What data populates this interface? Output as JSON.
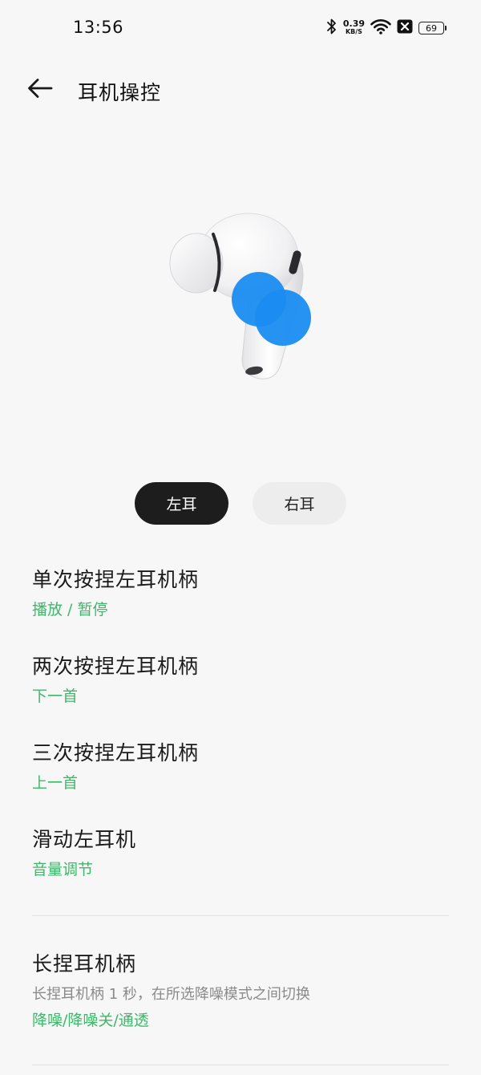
{
  "status_bar": {
    "time": "13:56",
    "net_speed_value": "0.39",
    "net_speed_unit": "KB/S",
    "battery": "69",
    "icons": [
      "bluetooth-icon",
      "wifi-icon",
      "notification-icon",
      "battery-icon"
    ]
  },
  "header": {
    "title": "耳机操控",
    "back_icon": "arrow-left-icon"
  },
  "ear_toggle": {
    "left_label": "左耳",
    "right_label": "右耳",
    "selected": "left"
  },
  "controls": [
    {
      "title": "单次按捏左耳机柄",
      "value": "播放 / 暂停"
    },
    {
      "title": "两次按捏左耳机柄",
      "value": "下一首"
    },
    {
      "title": "三次按捏左耳机柄",
      "value": "上一首"
    },
    {
      "title": "滑动左耳机",
      "value": "音量调节"
    }
  ],
  "long_press": {
    "title": "长捏耳机柄",
    "description": "长捏耳机柄 1 秒，在所选降噪模式之间切换",
    "value": "降噪/降噪关/通透"
  },
  "colors": {
    "accent_green": "#3fb76a",
    "selected_bg": "#1d1d1d",
    "unselected_bg": "#ededed",
    "highlight_blue": "#1a8cf0",
    "background": "#f8f7f8"
  }
}
